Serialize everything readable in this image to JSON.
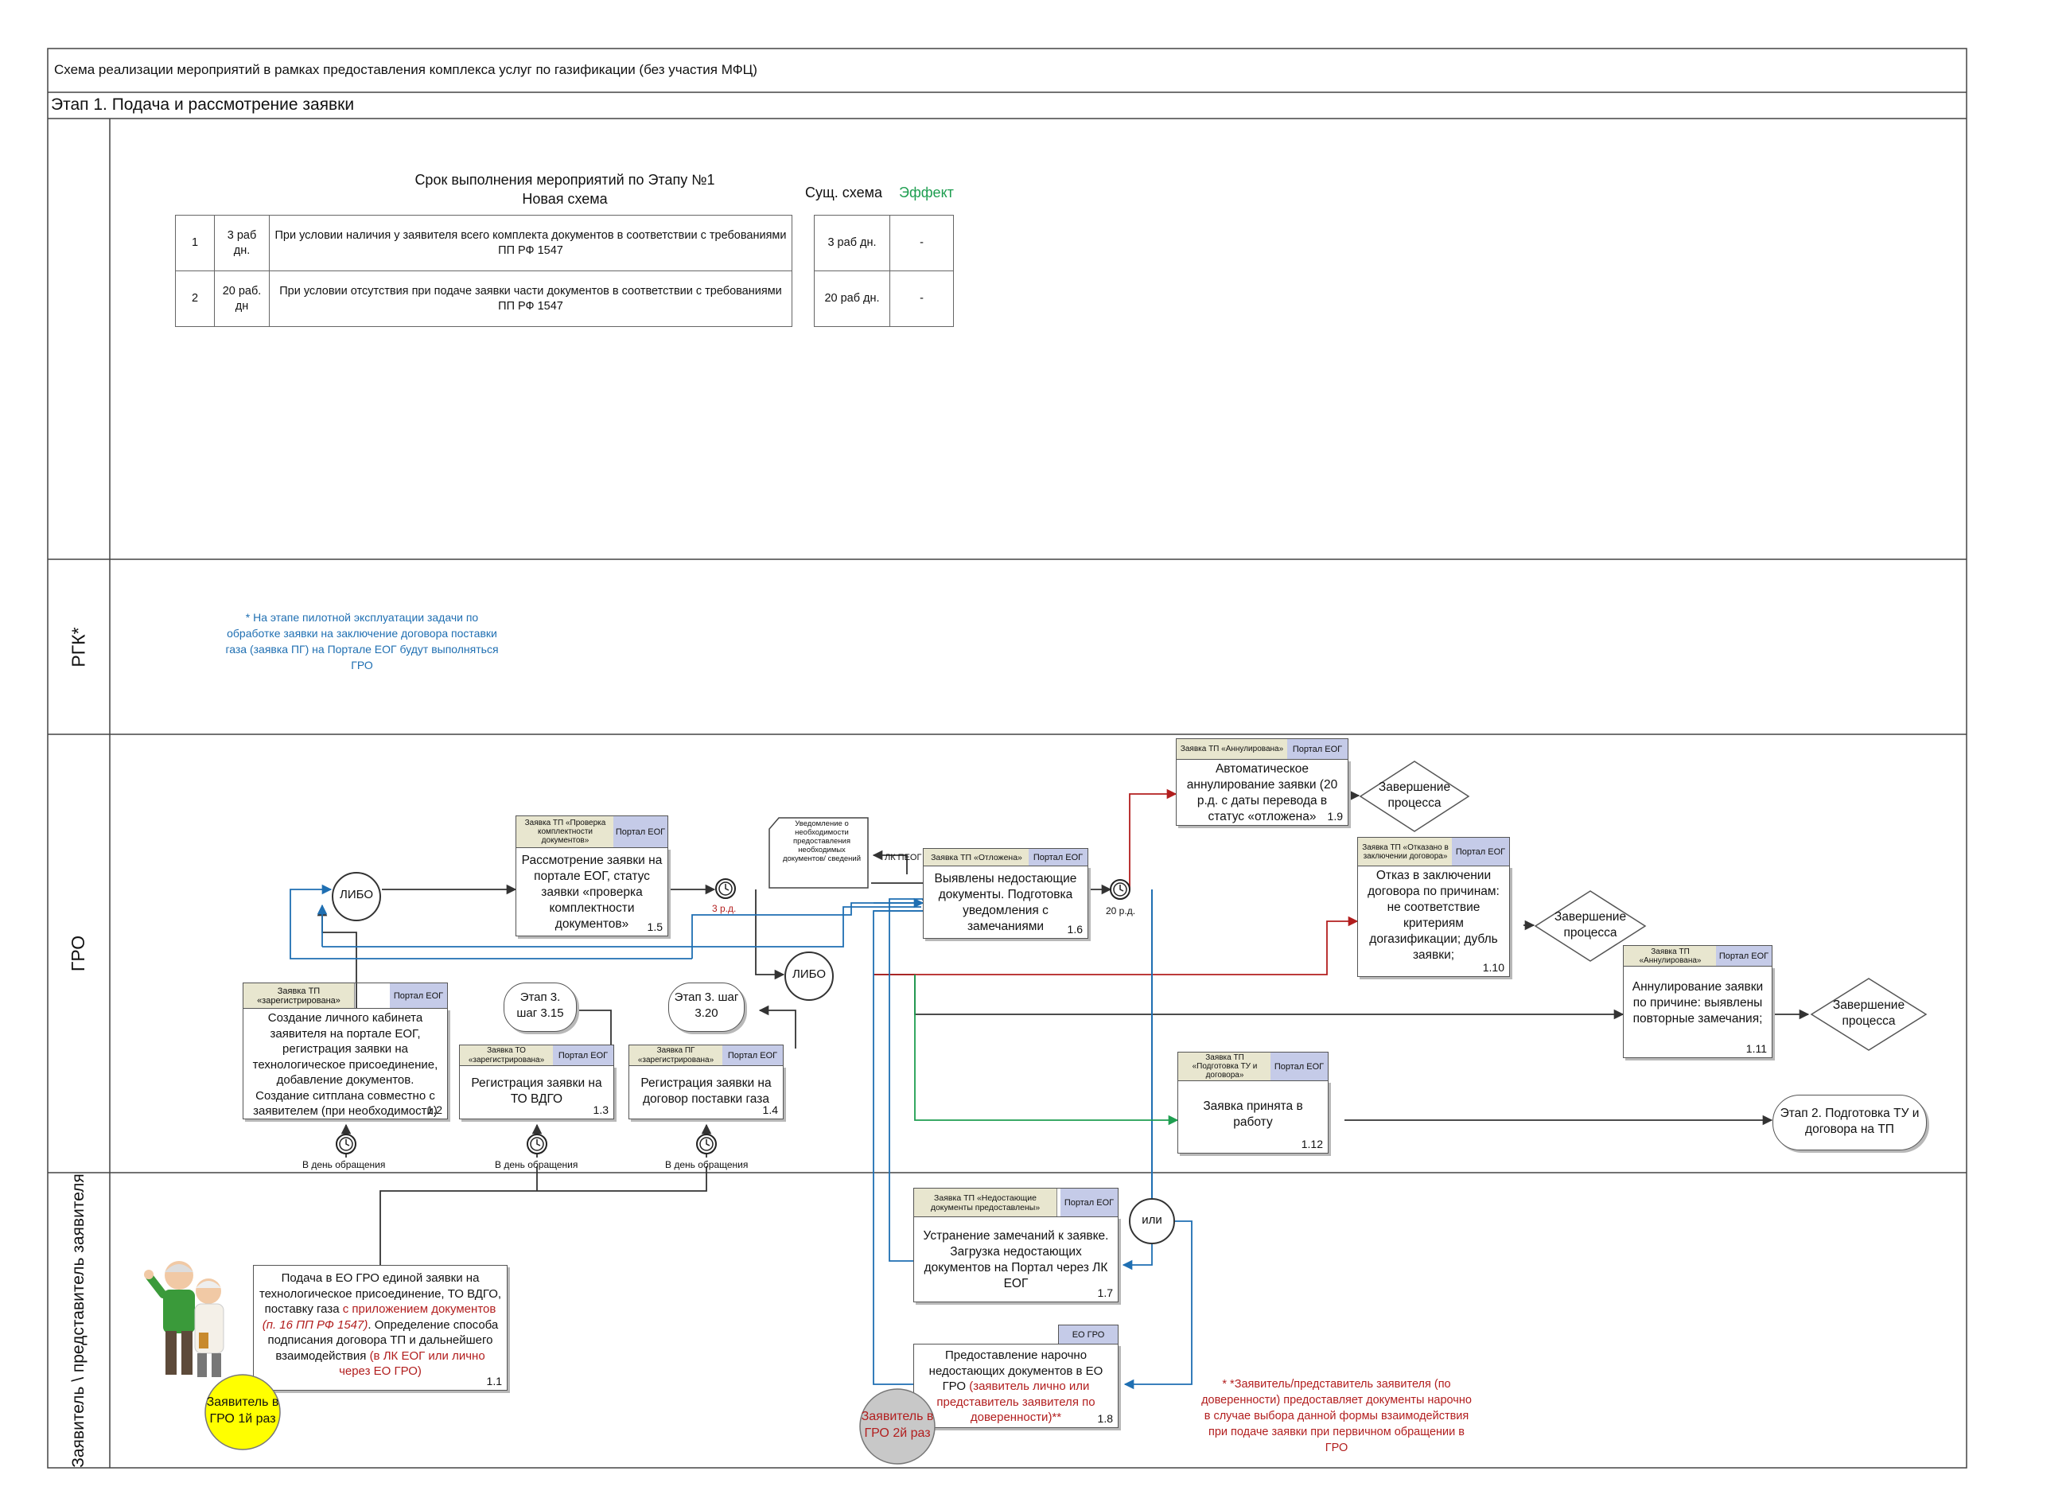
{
  "header": {
    "title": "Схема реализации мероприятий в рамках предоставления комплекса услуг по газификации (без участия МФЦ)",
    "stage": "Этап 1. Подача и рассмотрение заявки"
  },
  "lanes": {
    "rgk": "РГК*",
    "gro": "ГРО",
    "applicant": "Заявитель \\ представитель заявителя"
  },
  "timing": {
    "caption_line1": "Срок выполнения мероприятий по Этапу №1",
    "caption_line2": "Новая схема",
    "existing_header": "Сущ. схема",
    "effect_header": "Эффект",
    "rows": [
      {
        "n": "1",
        "days": "3 раб дн.",
        "condition": "При условии наличия у заявителя всего комплекта документов в соответствии с требованиями ПП РФ 1547",
        "existing": "3 раб дн.",
        "effect": "-"
      },
      {
        "n": "2",
        "days": "20 раб. дн",
        "condition": "При условии отсутствия при подаче заявки части документов в соответствии с требованиями ПП РФ 1547",
        "existing": "20 раб дн.",
        "effect": "-"
      }
    ]
  },
  "notes": {
    "rgk_note": "* На этапе пилотной эксплуатации задачи по обработке заявки на заключение договора поставки газа (заявка ПГ) на Портале ЕОГ будут выполняться ГРО",
    "applicant_note": "* *Заявитель/представитель заявителя (по доверенности) предоставляет документы нарочно в случае выбора данной формы взаимодействия при подаче заявки при первичном обращении в ГРО"
  },
  "gateways": {
    "libo1": "ЛИБО",
    "libo2": "ЛИБО",
    "ili": "или"
  },
  "timers": {
    "t3": "3 р.д.",
    "t20": "20 р.д.",
    "same_day": "В день обращения"
  },
  "doc_notice": "Уведомление о необходимости предоставления необходимых документов/ сведений",
  "lk_peog": "ЛК ПЕОГ",
  "tasks": {
    "t1_1": {
      "text1": "Подача в ЕО ГРО единой заявки на технологическое присоединение, ТО ВДГО, поставку газа ",
      "text_red1": "с приложением документов",
      "text_red2": "(п. 16 ПП РФ 1547)",
      "text2": ". Определение способа подписания договора ТП и дальнейшего взаимодействия ",
      "text_red3": "(в ЛК ЕОГ или лично через ЕО ГРО)",
      "num": "1.1"
    },
    "t1_2": {
      "status": "Заявка ТП «зарегистрирована»",
      "system": "Портал ЕОГ",
      "text": "Создание личного кабинета заявителя на портале ЕОГ, регистрация заявки на технологическое присоединение, добавление документов. Создание ситплана совместно с заявителем (при необходимости)",
      "num": "1.2"
    },
    "t1_3": {
      "status": "Заявка ТО «зарегистрирована»",
      "system": "Портал ЕОГ",
      "text": "Регистрация заявки на ТО ВДГО",
      "num": "1.3"
    },
    "t1_4": {
      "status": "Заявка ПГ «зарегистрирована»",
      "system": "Портал ЕОГ",
      "text": "Регистрация заявки на договор поставки газа",
      "num": "1.4"
    },
    "t1_5": {
      "status": "Заявка ТП «Проверка комплектности документов»",
      "system": "Портал ЕОГ",
      "text": "Рассмотрение заявки на портале ЕОГ, статус заявки «проверка комплектности документов»",
      "num": "1.5"
    },
    "t1_6": {
      "status": "Заявка ТП «Отложена»",
      "system": "Портал ЕОГ",
      "text": "Выявлены недостающие документы. Подготовка уведомления с замечаниями",
      "num": "1.6"
    },
    "t1_7": {
      "status": "Заявка ТП «Недостающие документы предоставлены»",
      "system": "Портал ЕОГ",
      "text": "Устранение замечаний к заявке. Загрузка недостающих документов на Портал через ЛК ЕОГ",
      "num": "1.7"
    },
    "t1_8": {
      "system": "ЕО ГРО",
      "text": "Предоставление нарочно недостающих документов в ЕО ГРО ",
      "text_red": "(заявитель лично или представитель заявителя по доверенности)**",
      "num": "1.8"
    },
    "t1_9": {
      "status": "Заявка ТП «Аннулирована»",
      "system": "Портал ЕОГ",
      "text": "Автоматическое аннулирование заявки (20 р.д. с даты перевода в статус «отложена»",
      "num": "1.9"
    },
    "t1_10": {
      "status": "Заявка ТП «Отказано в заключении договора»",
      "system": "Портал ЕОГ",
      "text": "Отказ в заключении договора по причинам: не соответствие критериям догазификации; дубль заявки;",
      "num": "1.10"
    },
    "t1_11": {
      "status": "Заявка ТП «Аннулирована»",
      "system": "Портал ЕОГ",
      "text": "Аннулирование заявки по причине: выявлены повторные замечания;",
      "num": "1.11"
    },
    "t1_12": {
      "status": "Заявка ТП «Подготовка ТУ и договора»",
      "system": "Портал ЕОГ",
      "text": "Заявка принята в работу",
      "num": "1.12"
    }
  },
  "ends": {
    "e1": "Завершение процесса",
    "e2": "Завершение процесса",
    "e3": "Завершение процесса"
  },
  "refs": {
    "r315": "Этап 3. шаг 3.15",
    "r320": "Этап 3. шаг 3.20",
    "next_stage": "Этап 2. Подготовка ТУ и договора на ТП"
  },
  "actors": {
    "first": "Заявитель в ГРО 1й раз",
    "second": "Заявитель в ГРО 2й раз"
  },
  "colors": {
    "red": "#b21e1e",
    "blue": "#1f6fb2",
    "green": "#1e9e50",
    "status_bg": "#e8e6cf",
    "system_bg": "#c5cbe8",
    "yellow": "#ffff00",
    "grey_actor": "#c8c8c8"
  }
}
